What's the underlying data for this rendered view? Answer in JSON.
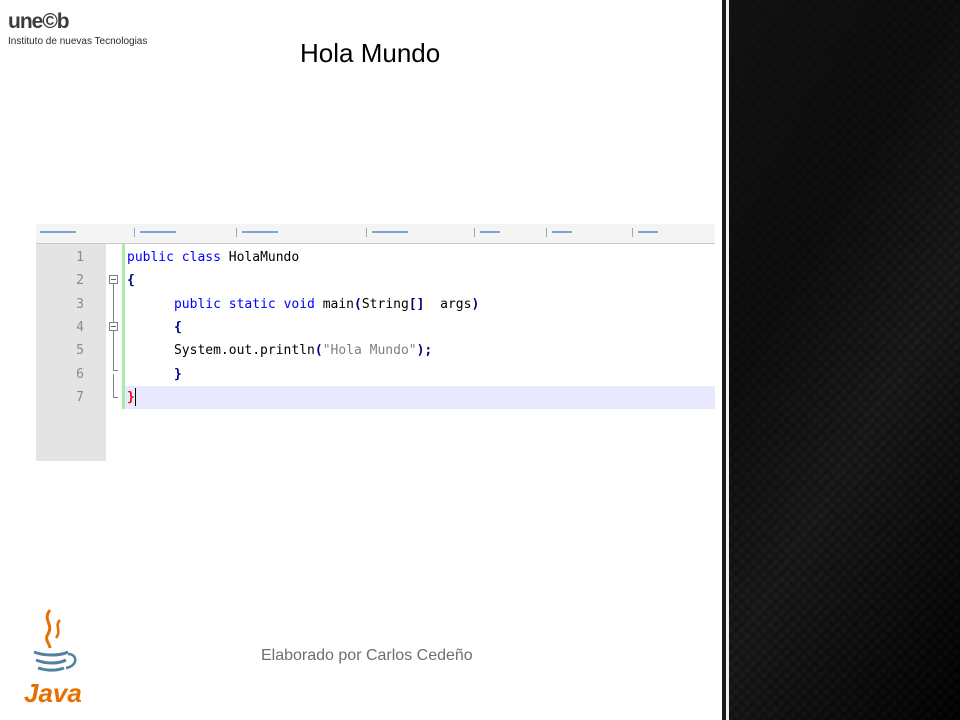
{
  "header": {
    "logo_mark": "une©b",
    "logo_subtitle": "Instituto de nuevas Tecnologias",
    "title": "Hola Mundo"
  },
  "editor": {
    "line_numbers": [
      "1",
      "2",
      "3",
      "4",
      "5",
      "6",
      "7"
    ],
    "lines": [
      {
        "indent": "",
        "tokens": [
          {
            "t": "public",
            "c": "kw"
          },
          {
            "t": " ",
            "c": ""
          },
          {
            "t": "class",
            "c": "kw"
          },
          {
            "t": " HolaMundo",
            "c": ""
          }
        ]
      },
      {
        "indent": "",
        "tokens": [
          {
            "t": "{",
            "c": "sym"
          }
        ]
      },
      {
        "indent": "      ",
        "tokens": [
          {
            "t": "public",
            "c": "kw"
          },
          {
            "t": " ",
            "c": ""
          },
          {
            "t": "static",
            "c": "kw"
          },
          {
            "t": " ",
            "c": ""
          },
          {
            "t": "void",
            "c": "kw"
          },
          {
            "t": " main",
            "c": ""
          },
          {
            "t": "(",
            "c": "sym"
          },
          {
            "t": "String",
            "c": ""
          },
          {
            "t": "[]",
            "c": "sym"
          },
          {
            "t": "  args",
            "c": ""
          },
          {
            "t": ")",
            "c": "sym"
          }
        ]
      },
      {
        "indent": "      ",
        "tokens": [
          {
            "t": "{",
            "c": "sym"
          }
        ]
      },
      {
        "indent": "      ",
        "tokens": [
          {
            "t": "System.out.println",
            "c": ""
          },
          {
            "t": "(",
            "c": "sym"
          },
          {
            "t": "\"Hola Mundo\"",
            "c": "str"
          },
          {
            "t": ");",
            "c": "sym"
          }
        ]
      },
      {
        "indent": "      ",
        "tokens": [
          {
            "t": "}",
            "c": "sym"
          }
        ]
      },
      {
        "indent": "",
        "tokens": [
          {
            "t": "}",
            "c": "brace-red"
          }
        ]
      }
    ]
  },
  "footer": {
    "credit": "Elaborado por Carlos Cedeño"
  },
  "java_logo": {
    "word": "Java"
  },
  "colors": {
    "keyword": "#0000ff",
    "operator": "#000080",
    "string": "#808080",
    "current_line": "#e8e8ff",
    "java_orange": "#e76f00",
    "java_blue": "#5382a1"
  }
}
